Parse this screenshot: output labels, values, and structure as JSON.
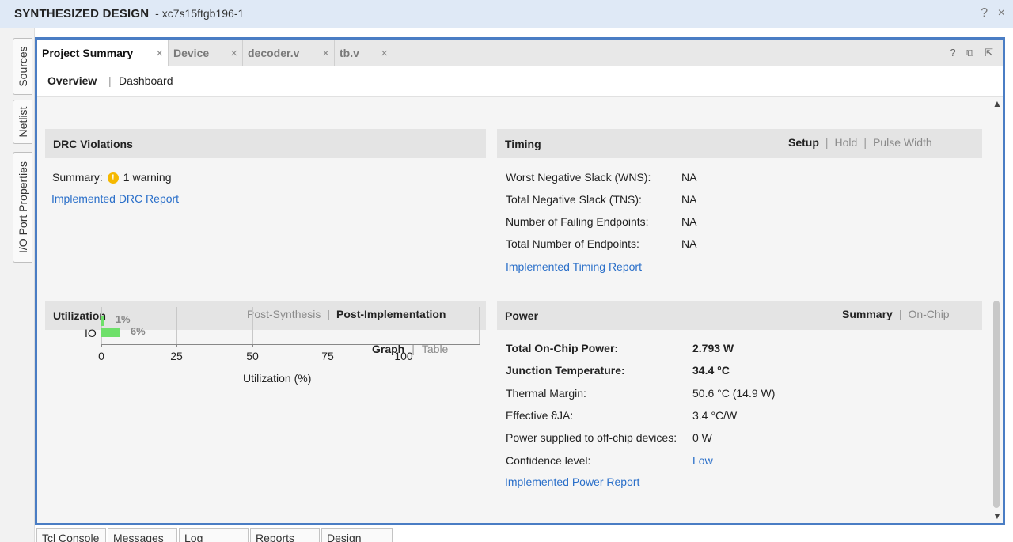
{
  "window": {
    "title": "SYNTHESIZED DESIGN",
    "part": "xc7s15ftgb196-1",
    "help_icon": "?",
    "close_icon": "×"
  },
  "left_tabs": [
    "Sources",
    "Netlist",
    "I/O Port Properties"
  ],
  "tabs": [
    {
      "label": "Project Summary",
      "active": true
    },
    {
      "label": "Device",
      "active": false
    },
    {
      "label": "decoder.v",
      "active": false
    },
    {
      "label": "tb.v",
      "active": false
    }
  ],
  "tab_close": "×",
  "tabbar_icons": {
    "help": "?",
    "restore": "⧉",
    "float": "⇱"
  },
  "subtabs": {
    "overview": "Overview",
    "dashboard": "Dashboard"
  },
  "drc": {
    "title": "DRC Violations",
    "summary_label": "Summary:",
    "summary_value": "1 warning",
    "report_link": "Implemented DRC Report"
  },
  "timing": {
    "title": "Timing",
    "options": [
      "Setup",
      "Hold",
      "Pulse Width"
    ],
    "active_option": "Setup",
    "rows": [
      {
        "label": "Worst Negative Slack (WNS):",
        "value": "NA"
      },
      {
        "label": "Total Negative Slack (TNS):",
        "value": "NA"
      },
      {
        "label": "Number of Failing Endpoints:",
        "value": "NA"
      },
      {
        "label": "Total Number of Endpoints:",
        "value": "NA"
      }
    ],
    "report_link": "Implemented Timing Report"
  },
  "utilization": {
    "title": "Utilization",
    "options": [
      "Post-Synthesis",
      "Post-Implementation"
    ],
    "active_option": "Post-Implementation",
    "view_options": [
      "Graph",
      "Table"
    ],
    "active_view": "Graph"
  },
  "chart_data": {
    "type": "bar",
    "orientation": "horizontal",
    "categories": [
      "IO"
    ],
    "series": [
      {
        "values": [
          1
        ],
        "label": "1%"
      },
      {
        "values": [
          6
        ],
        "label": "6%"
      }
    ],
    "xlabel": "Utilization (%)",
    "xticks": [
      "0",
      "25",
      "50",
      "75",
      "100"
    ],
    "xlim": [
      0,
      125
    ],
    "grid": true
  },
  "power": {
    "title": "Power",
    "options": [
      "Summary",
      "On-Chip"
    ],
    "active_option": "Summary",
    "rows": [
      {
        "label": "Total On-Chip Power:",
        "value": "2.793 W",
        "bold": true
      },
      {
        "label": "Junction Temperature:",
        "value": "34.4 °C",
        "bold": true
      },
      {
        "label": "Thermal Margin:",
        "value": "50.6 °C (14.9 W)",
        "bold": false
      },
      {
        "label": "Effective ϑJA:",
        "value": "3.4 °C/W",
        "bold": false
      },
      {
        "label": "Power supplied to off-chip devices:",
        "value": "0 W",
        "bold": false
      },
      {
        "label": "Confidence level:",
        "value": "Low",
        "bold": false,
        "link": true
      }
    ],
    "report_link": "Implemented Power Report"
  },
  "bottom_tabs": [
    "Tcl Console",
    "Messages",
    "Log",
    "Reports",
    "Design Runs"
  ],
  "colors": {
    "accent": "#4a7dc4",
    "link": "#2a6fc9",
    "bar": "#6ee06a",
    "warning": "#f5b800"
  }
}
